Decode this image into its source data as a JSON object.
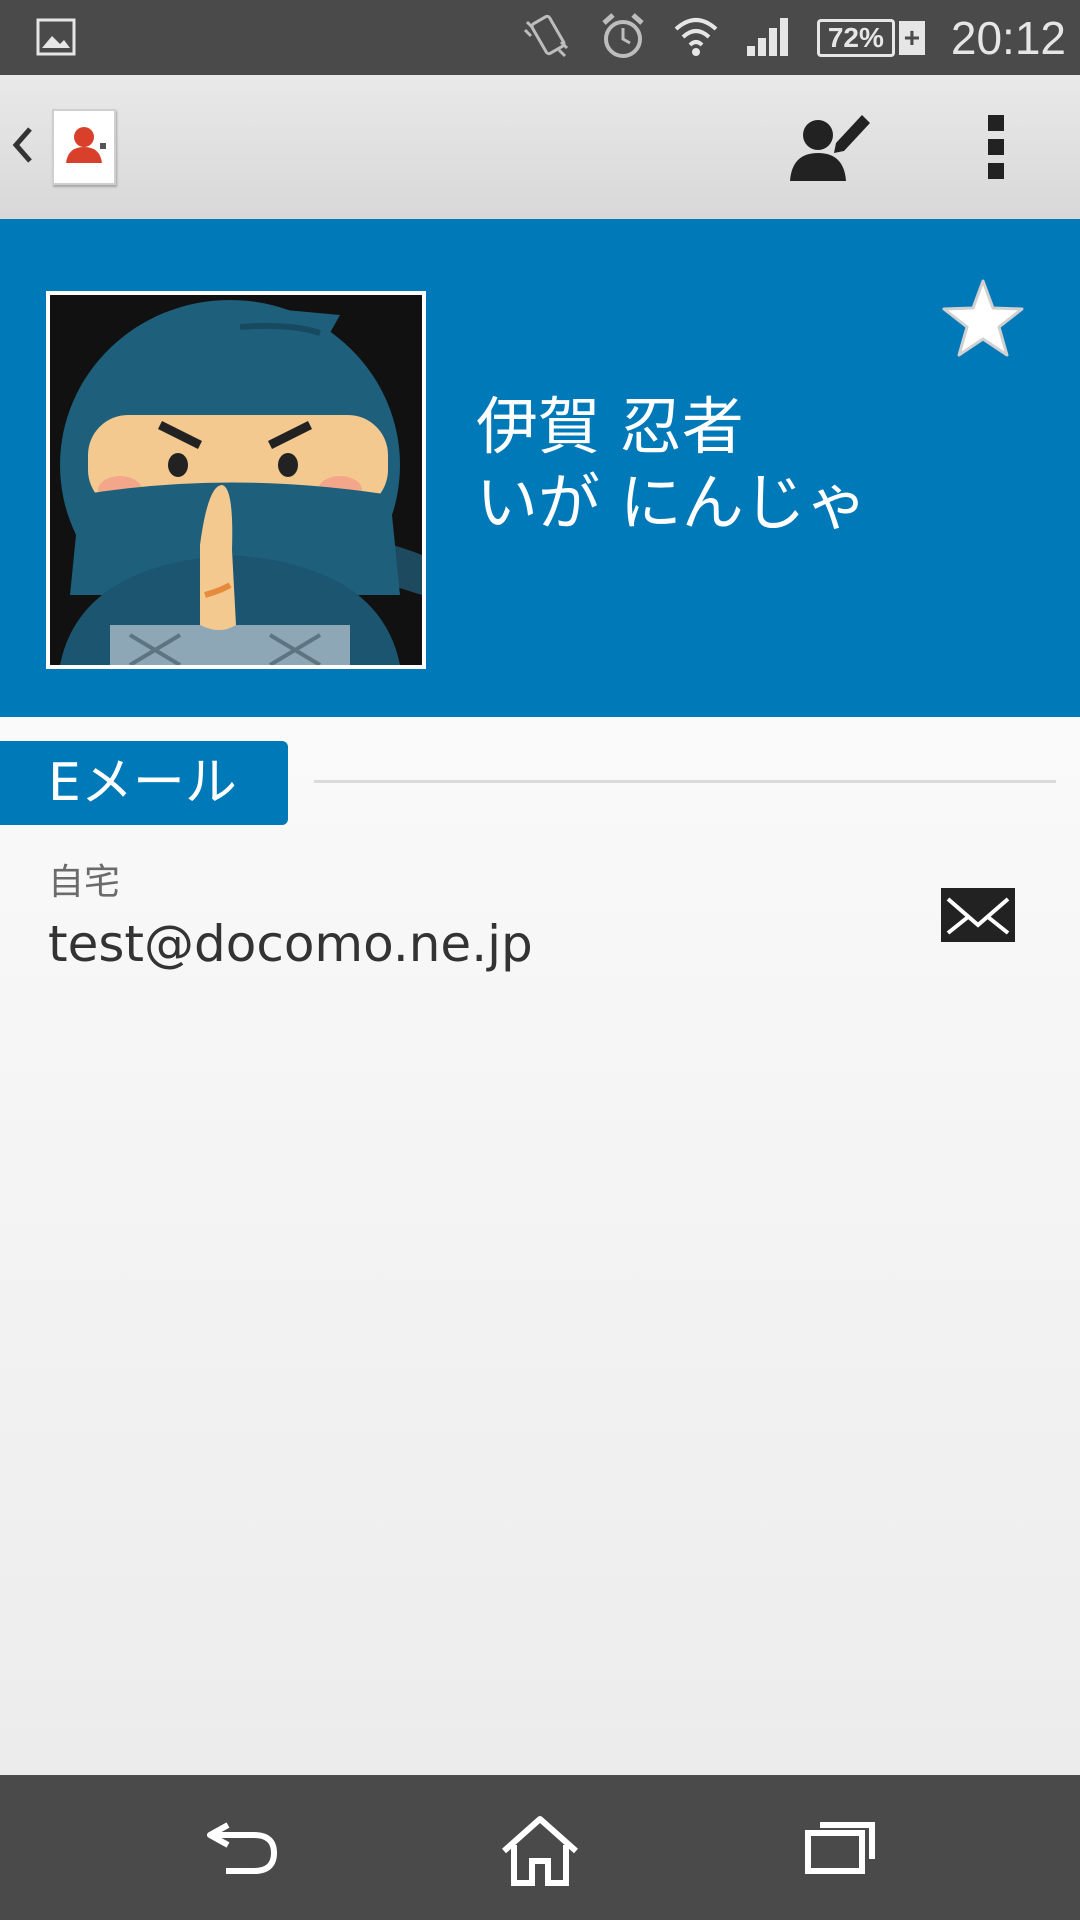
{
  "status_bar": {
    "battery_percent": "72%",
    "charging_symbol": "+",
    "time": "20:12",
    "icons": [
      "gallery-icon",
      "vibrate-icon",
      "alarm-icon",
      "wifi-icon",
      "signal-icon",
      "battery-icon"
    ]
  },
  "action_bar": {
    "icons": [
      "back-chevron-icon",
      "contacts-app-icon",
      "edit-contact-icon",
      "overflow-menu-icon"
    ]
  },
  "contact": {
    "name": "伊賀 忍者",
    "phonetic": "いが にんじゃ",
    "photo": "ninja-avatar",
    "starred": false
  },
  "email_section": {
    "title": "Eメール",
    "entries": [
      {
        "type": "自宅",
        "address": "test@docomo.ne.jp"
      }
    ]
  },
  "nav_bar": {
    "icons": [
      "back-icon",
      "home-icon",
      "recents-icon"
    ]
  },
  "colors": {
    "accent": "#0079b8",
    "status_bar": "#4a4a4a",
    "nav_bar": "#4a4a4a"
  }
}
